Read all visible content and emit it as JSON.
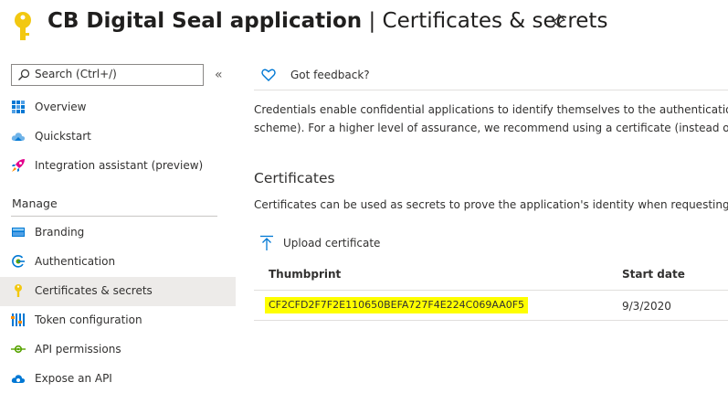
{
  "header": {
    "app_name": "CB Digital Seal application",
    "separator": "|",
    "page_name": "Certificates & secrets",
    "pin_icon": "pin-icon",
    "app_icon": "key-icon",
    "key_color": "#f2c811"
  },
  "sidebar": {
    "search_placeholder": "Search (Ctrl+/)",
    "collapse_glyph": "«",
    "items_top": [
      {
        "label": "Overview",
        "icon": "grid-icon"
      },
      {
        "label": "Quickstart",
        "icon": "cloud-icon"
      },
      {
        "label": "Integration assistant (preview)",
        "icon": "rocket-icon"
      }
    ],
    "section_label": "Manage",
    "items_manage": [
      {
        "label": "Branding",
        "icon": "branding-icon"
      },
      {
        "label": "Authentication",
        "icon": "authentication-icon"
      },
      {
        "label": "Certificates & secrets",
        "icon": "key-icon",
        "active": true
      },
      {
        "label": "Token configuration",
        "icon": "token-bars-icon"
      },
      {
        "label": "API permissions",
        "icon": "api-permissions-icon"
      },
      {
        "label": "Expose an API",
        "icon": "cloud-expose-icon"
      }
    ]
  },
  "content": {
    "feedback_label": "Got feedback?",
    "description_line1": "Credentials enable confidential applications to identify themselves to the authentication se",
    "description_line2": "scheme). For a higher level of assurance, we recommend using a certificate (instead of a",
    "certificates_heading": "Certificates",
    "certificates_description": "Certificates can be used as secrets to prove the application's identity when requesting a t",
    "upload_label": "Upload certificate",
    "table": {
      "columns": [
        "Thumbprint",
        "Start date"
      ],
      "rows": [
        {
          "thumbprint": "CF2CFD2F7F2E110650BEFA727F4E224C069AA0F5",
          "start_date": "9/3/2020"
        }
      ]
    },
    "highlight_color": "#fefe00"
  }
}
